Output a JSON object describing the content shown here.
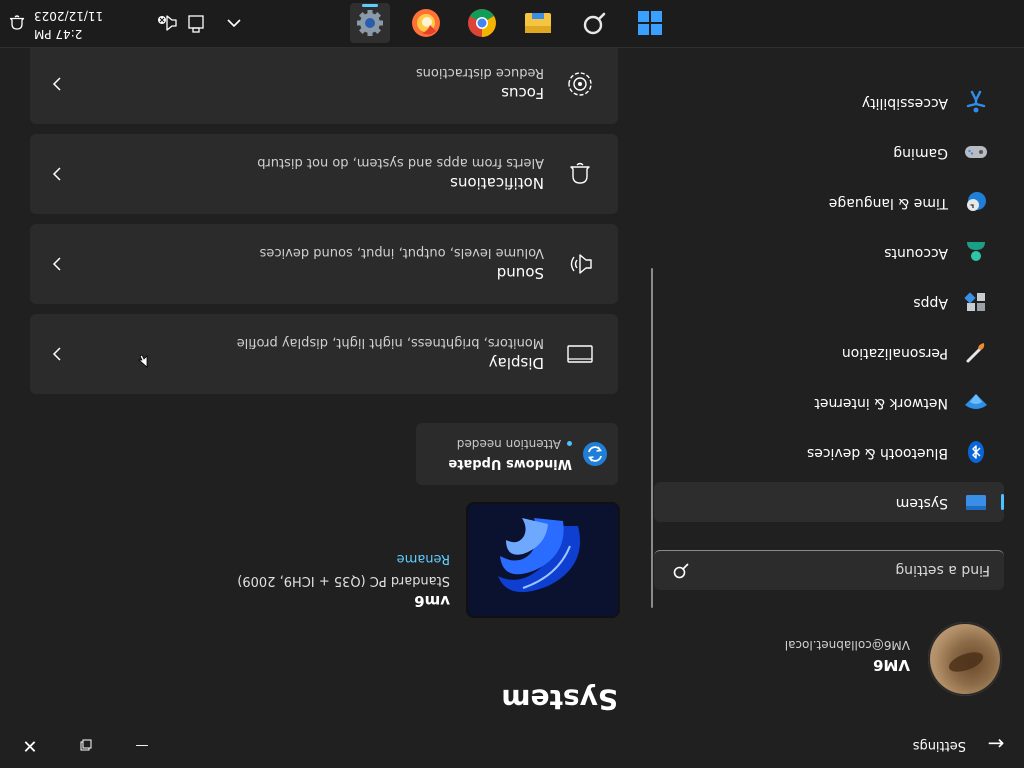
{
  "window": {
    "title": "Settings",
    "back_icon": "back-arrow-icon",
    "minimize_icon": "minimize-icon",
    "maximize_icon": "maximize-icon",
    "close_icon": "close-icon"
  },
  "sidebar": {
    "profile": {
      "name": "VM6",
      "email": "VM6@collabnet.local"
    },
    "search": {
      "placeholder": "Find a setting",
      "icon": "search-icon"
    },
    "items": [
      {
        "label": "System",
        "icon": "system-display-icon",
        "active": true
      },
      {
        "label": "Bluetooth & devices",
        "icon": "bluetooth-icon",
        "active": false
      },
      {
        "label": "Network & internet",
        "icon": "network-wifi-icon",
        "active": false
      },
      {
        "label": "Personalization",
        "icon": "paintbrush-icon",
        "active": false
      },
      {
        "label": "Apps",
        "icon": "apps-grid-icon",
        "active": false
      },
      {
        "label": "Accounts",
        "icon": "account-person-icon",
        "active": false
      },
      {
        "label": "Time & language",
        "icon": "globe-clock-icon",
        "active": false
      },
      {
        "label": "Gaming",
        "icon": "gamepad-icon",
        "active": false
      },
      {
        "label": "Accessibility",
        "icon": "accessibility-icon",
        "active": false
      }
    ]
  },
  "main": {
    "page_title": "System",
    "device": {
      "name": "vm6",
      "model": "Standard PC (Q35 + ICH9, 2009)",
      "rename_label": "Rename"
    },
    "windows_update": {
      "title": "Windows Update",
      "status": "Attention needed",
      "icon": "windows-update-sync-icon"
    },
    "settings": [
      {
        "title": "Display",
        "subtitle": "Monitors, brightness, night light, display profile",
        "icon": "display-monitor-icon"
      },
      {
        "title": "Sound",
        "subtitle": "Volume levels, output, input, sound devices",
        "icon": "speaker-icon"
      },
      {
        "title": "Notifications",
        "subtitle": "Alerts from apps and system, do not disturb",
        "icon": "bell-icon"
      },
      {
        "title": "Focus",
        "subtitle": "Reduce distractions",
        "icon": "focus-icon"
      }
    ]
  },
  "taskbar": {
    "apps": [
      {
        "name": "Start",
        "icon": "windows-start-icon"
      },
      {
        "name": "Search",
        "icon": "search-icon"
      },
      {
        "name": "File Explorer",
        "icon": "folder-icon"
      },
      {
        "name": "Chrome",
        "icon": "chrome-icon"
      },
      {
        "name": "Firefox",
        "icon": "firefox-icon"
      },
      {
        "name": "Settings",
        "icon": "gear-icon",
        "active": true
      }
    ],
    "tray": {
      "time": "2:47 PM",
      "date": "11/12/2023"
    }
  },
  "colors": {
    "background": "#202020",
    "card": "#2b2b2b",
    "accent": "#4cc2ff",
    "link": "#60cdff",
    "taskbar": "#1c1c1c"
  }
}
